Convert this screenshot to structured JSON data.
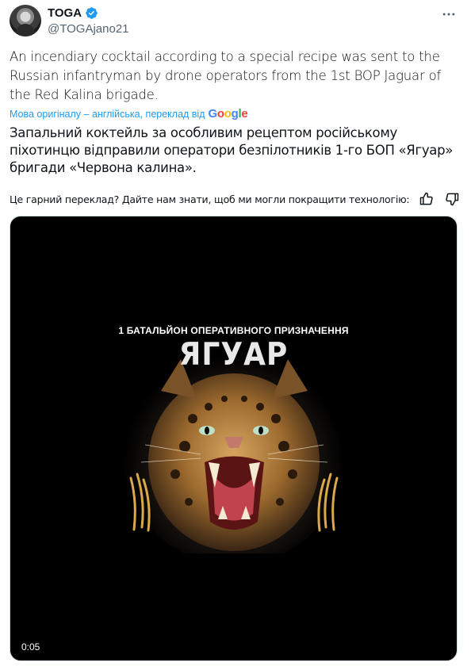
{
  "author": {
    "display_name": "TOGA",
    "handle": "@TOGAjano21",
    "verified": true,
    "verified_color": "#1d9bf0"
  },
  "tweet": {
    "text": "An incendiary cocktail according to a special recipe was sent to the Russian infantryman by drone operators from the 1st BOP Jaguar of the Red Kalina brigade."
  },
  "translation": {
    "meta_label": "Мова оригіналу – англійська, переклад від",
    "provider": "Google",
    "text": "Запальний коктейль за особливим рецептом російському піхотинцю відправили оператори безпілотників 1-го БОП «Ягуар» бригади «Червона калина».",
    "feedback_prompt": "Це гарний переклад? Дайте нам знати, щоб ми могли покращити технологію:"
  },
  "media": {
    "subtitle": "1 БАТАЛЬЙОН ОПЕРАТИВНОГО ПРИЗНАЧЕННЯ",
    "title": "ЯГУАР",
    "timestamp": "0:05"
  },
  "icons": [
    "verified-badge-icon",
    "more-options-icon",
    "thumbs-up-icon",
    "thumbs-down-icon"
  ],
  "colors": {
    "link": "#1d9bf0",
    "text": "#0f1419",
    "muted": "#536471",
    "media_bg": "#000000"
  }
}
